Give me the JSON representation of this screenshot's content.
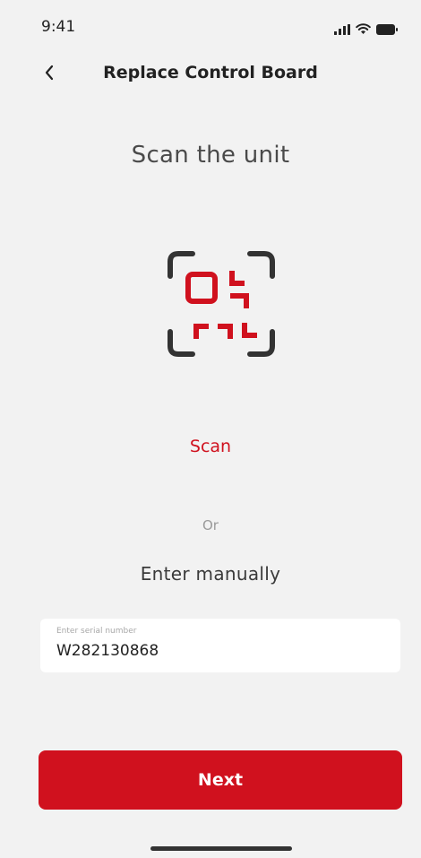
{
  "status_bar": {
    "time": "9:41",
    "icons": [
      "signal-icon",
      "wifi-icon",
      "battery-icon"
    ]
  },
  "nav": {
    "back_icon": "chevron-left-icon",
    "title": "Replace Control Board"
  },
  "content": {
    "heading": "Scan the unit",
    "illustration_icon": "qr-scan-icon",
    "scan_label": "Scan",
    "or_label": "Or",
    "manual_heading": "Enter manually",
    "serial_field": {
      "label": "Enter serial number",
      "value": "W282130868"
    }
  },
  "footer": {
    "next_label": "Next"
  },
  "colors": {
    "accent": "#d0111e",
    "background": "#f2f2f2",
    "frame": "#333333"
  }
}
